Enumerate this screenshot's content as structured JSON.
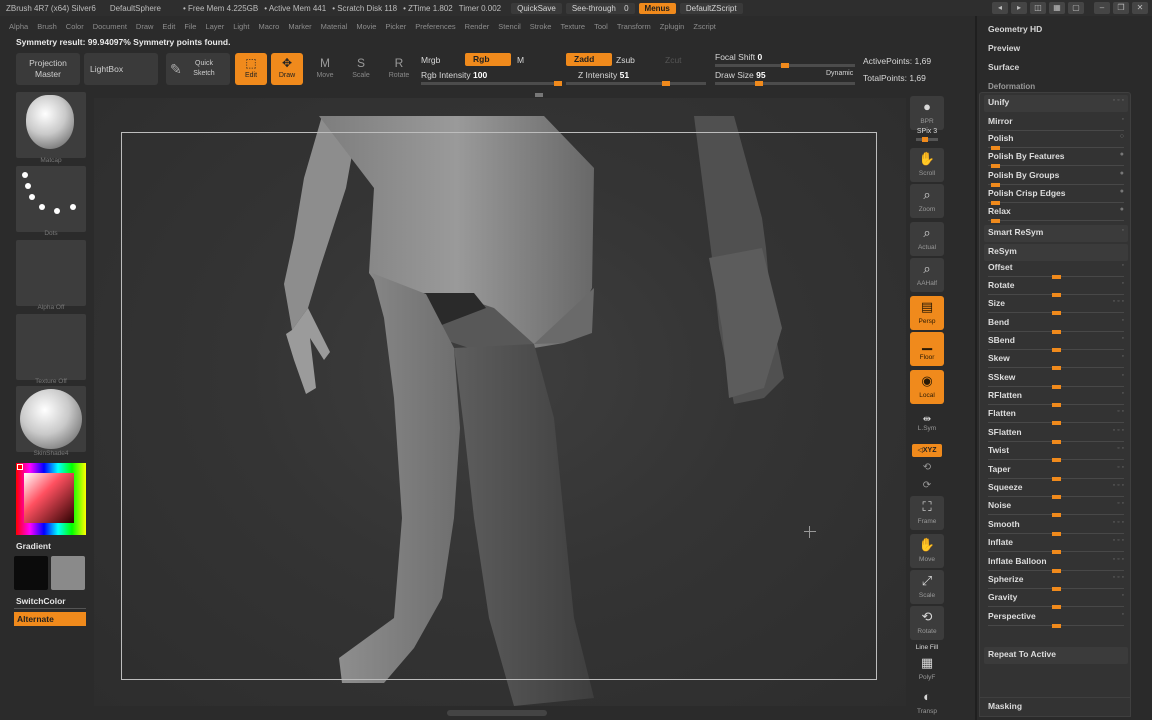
{
  "titlebar": {
    "app": "ZBrush 4R7 (x64) Silver6",
    "document": "DefaultSphere",
    "free_mem": "• Free Mem 4.225GB",
    "active_mem": "• Active Mem 441",
    "scratch": "• Scratch Disk 118",
    "ztime": "• ZTime 1.802",
    "timer": "Timer 0.002",
    "quicksave": "QuickSave",
    "see_through": "See-through",
    "see_through_value": "0",
    "menus": "Menus",
    "script": "DefaultZScript"
  },
  "menubar": [
    "Alpha",
    "Brush",
    "Color",
    "Document",
    "Draw",
    "Edit",
    "File",
    "Layer",
    "Light",
    "Macro",
    "Marker",
    "Material",
    "Movie",
    "Picker",
    "Preferences",
    "Render",
    "Stencil",
    "Stroke",
    "Texture",
    "Tool",
    "Transform",
    "Zplugin",
    "Zscript"
  ],
  "status": "Symmetry result: 99.94097% Symmetry points found.",
  "toolbar": {
    "projection_master": [
      "Projection",
      "Master"
    ],
    "lightbox": "LightBox",
    "quick_sketch": [
      "Quick",
      "Sketch"
    ],
    "edit": "Edit",
    "draw": "Draw",
    "move": "Move",
    "scale": "Scale",
    "rotate": "Rotate",
    "mrgb": "Mrgb",
    "rgb": "Rgb",
    "m": "M",
    "rgb_intensity_label": "Rgb Intensity",
    "rgb_intensity": "100",
    "zadd": "Zadd",
    "zsub": "Zsub",
    "zcut": "Zcut",
    "z_intensity_label": "Z Intensity",
    "z_intensity": "51",
    "focal_shift_label": "Focal Shift",
    "focal_shift": "0",
    "draw_size_label": "Draw Size",
    "draw_size": "95",
    "dynamic": "Dynamic",
    "active_points_label": "ActivePoints:",
    "active_points": "1,69",
    "total_points_label": "TotalPoints:",
    "total_points": "1,69"
  },
  "leftpanel": {
    "material_label": "Matcap",
    "brush_label": "Dots",
    "alpha_label": "Alpha Off",
    "texture_label": "Texture Off",
    "matcap2_label": "SkinShade4",
    "gradient": "Gradient",
    "switchcolor": "SwitchColor",
    "alternate": "Alternate",
    "colors": {
      "primary": "#0b0b0b",
      "secondary": "#8a8a8a"
    }
  },
  "rightshelf": {
    "bpr": "BPR",
    "spix_label": "SPix",
    "spix": "3",
    "scroll": "Scroll",
    "zoom": "Zoom",
    "actual": "Actual",
    "aahalf": "AAHalf",
    "persp": "Persp",
    "floor": "Floor",
    "local": "Local",
    "lsym": "L.Sym",
    "xyz": "◁XYZ",
    "frame": "Frame",
    "move": "Move",
    "scale": "Scale",
    "rotate": "Rotate",
    "linefill": "Line Fill",
    "polyf": "PolyF",
    "transp": "Transp"
  },
  "tray": {
    "geometry_hd": "Geometry HD",
    "preview": "Preview",
    "surface": "Surface",
    "deformation": "Deformation",
    "masking": "Masking",
    "rows": [
      {
        "label": "Unify",
        "ind": "◦ ◦ ◦",
        "knob": null,
        "boxed": true
      },
      {
        "label": "Mirror",
        "ind": "◦",
        "knob": null,
        "boxed": false
      },
      {
        "label": "Polish",
        "ind": "○",
        "knob": 0.02,
        "boxed": false
      },
      {
        "label": "Polish By Features",
        "ind": "●",
        "knob": 0.02,
        "boxed": false
      },
      {
        "label": "Polish By Groups",
        "ind": "●",
        "knob": 0.02,
        "boxed": false
      },
      {
        "label": "Polish Crisp Edges",
        "ind": "●",
        "knob": 0.02,
        "boxed": false
      },
      {
        "label": "Relax",
        "ind": "●",
        "knob": 0.02,
        "boxed": false
      },
      {
        "label": "Smart ReSym",
        "ind": "◦",
        "knob": null,
        "boxed": true
      },
      {
        "label": "ReSym",
        "ind": "",
        "knob": null,
        "boxed": true
      },
      {
        "label": "Offset",
        "ind": "◦",
        "knob": 0.5,
        "boxed": false
      },
      {
        "label": "Rotate",
        "ind": "◦",
        "knob": 0.5,
        "boxed": false
      },
      {
        "label": "Size",
        "ind": "◦ ◦ ◦",
        "knob": 0.5,
        "boxed": false
      },
      {
        "label": "Bend",
        "ind": "◦",
        "knob": 0.5,
        "boxed": false
      },
      {
        "label": "SBend",
        "ind": "◦",
        "knob": 0.5,
        "boxed": false
      },
      {
        "label": "Skew",
        "ind": "◦",
        "knob": 0.5,
        "boxed": false
      },
      {
        "label": "SSkew",
        "ind": "◦",
        "knob": 0.5,
        "boxed": false
      },
      {
        "label": "RFlatten",
        "ind": "◦",
        "knob": 0.5,
        "boxed": false
      },
      {
        "label": "Flatten",
        "ind": "◦ ◦",
        "knob": 0.5,
        "boxed": false
      },
      {
        "label": "SFlatten",
        "ind": "◦ ◦ ◦",
        "knob": 0.5,
        "boxed": false
      },
      {
        "label": "Twist",
        "ind": "◦ ◦",
        "knob": 0.5,
        "boxed": false
      },
      {
        "label": "Taper",
        "ind": "◦ ◦",
        "knob": 0.5,
        "boxed": false
      },
      {
        "label": "Squeeze",
        "ind": "◦ ◦ ◦",
        "knob": 0.5,
        "boxed": false
      },
      {
        "label": "Noise",
        "ind": "◦ ◦",
        "knob": 0.5,
        "boxed": false
      },
      {
        "label": "Smooth",
        "ind": "◦ ◦ ◦",
        "knob": 0.5,
        "boxed": false
      },
      {
        "label": "Inflate",
        "ind": "◦ ◦ ◦",
        "knob": 0.5,
        "boxed": false
      },
      {
        "label": "Inflate Balloon",
        "ind": "◦ ◦ ◦",
        "knob": 0.5,
        "boxed": false
      },
      {
        "label": "Spherize",
        "ind": "◦ ◦ ◦",
        "knob": 0.5,
        "boxed": false
      },
      {
        "label": "Gravity",
        "ind": "◦",
        "knob": 0.5,
        "boxed": false
      },
      {
        "label": "Perspective",
        "ind": "◦",
        "knob": 0.5,
        "boxed": false
      },
      {
        "label": "Repeat To Active",
        "ind": "",
        "knob": null,
        "boxed": true
      }
    ]
  }
}
